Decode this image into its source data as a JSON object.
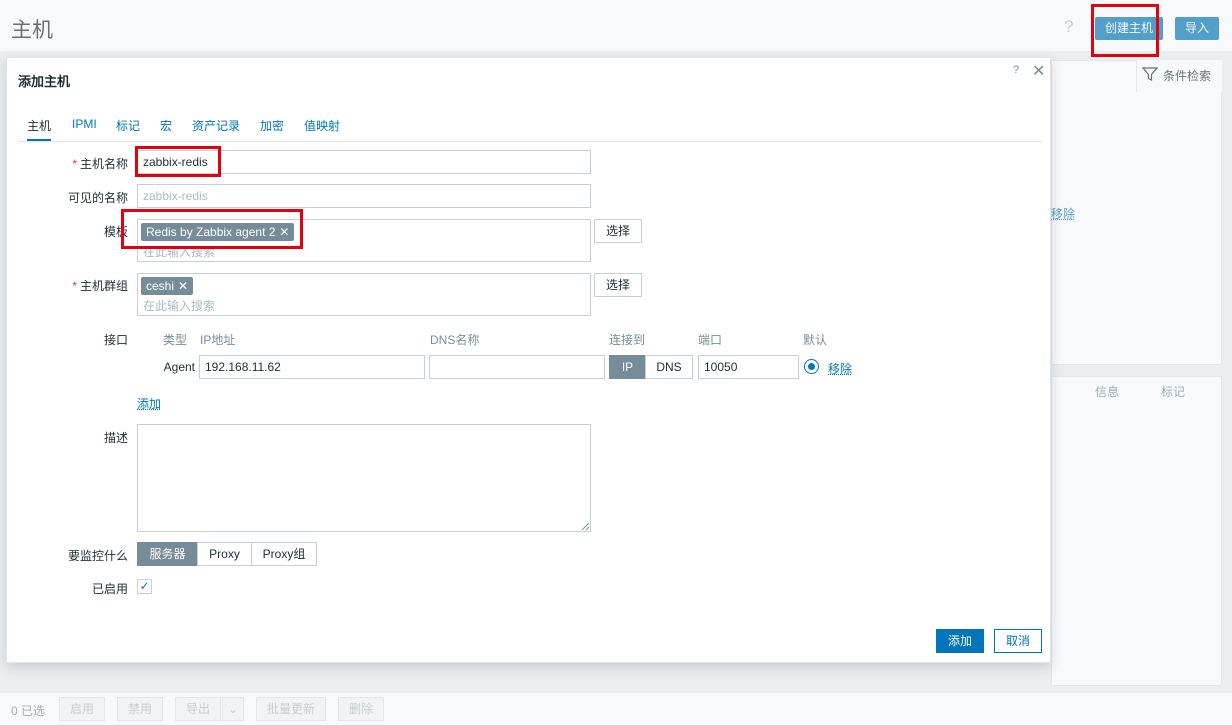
{
  "page": {
    "title": "主机",
    "help": "?",
    "create_host": "创建主机",
    "import": "导入",
    "filter_label": "条件检索",
    "bg_remove": "移除",
    "bg_columns": [
      "信息",
      "标记"
    ],
    "footer": {
      "selected": "0 已选",
      "buttons": [
        "启用",
        "禁用",
        "导出",
        "批量更新",
        "删除"
      ]
    }
  },
  "dialog": {
    "title": "添加主机",
    "help": "?",
    "close": "✕",
    "tabs": [
      "主机",
      "IPMI",
      "标记",
      "宏",
      "资产记录",
      "加密",
      "值映射"
    ],
    "host_name": {
      "label": "主机名称",
      "value": "zabbix-redis"
    },
    "visible_name": {
      "label": "可见的名称",
      "placeholder": "zabbix-redis"
    },
    "templates": {
      "label": "模板",
      "chip": "Redis by Zabbix agent 2",
      "placeholder": "在此输入搜索",
      "select": "选择"
    },
    "host_groups": {
      "label": "主机群组",
      "chip": "ceshi",
      "placeholder": "在此输入搜索",
      "select": "选择"
    },
    "interfaces": {
      "label": "接口",
      "headers": {
        "type": "类型",
        "ip": "IP地址",
        "dns": "DNS名称",
        "connect": "连接到",
        "port": "端口",
        "default": "默认"
      },
      "row": {
        "type": "Agent",
        "ip": "192.168.11.62",
        "dns": "",
        "connect_ip": "IP",
        "connect_dns": "DNS",
        "port": "10050",
        "remove": "移除"
      },
      "add": "添加"
    },
    "description": {
      "label": "描述"
    },
    "monitored_by": {
      "label": "要监控什么",
      "options": [
        "服务器",
        "Proxy",
        "Proxy组"
      ],
      "selected": "服务器"
    },
    "enabled": {
      "label": "已启用",
      "checked": "✓"
    },
    "add_button": "添加",
    "cancel_button": "取消"
  }
}
